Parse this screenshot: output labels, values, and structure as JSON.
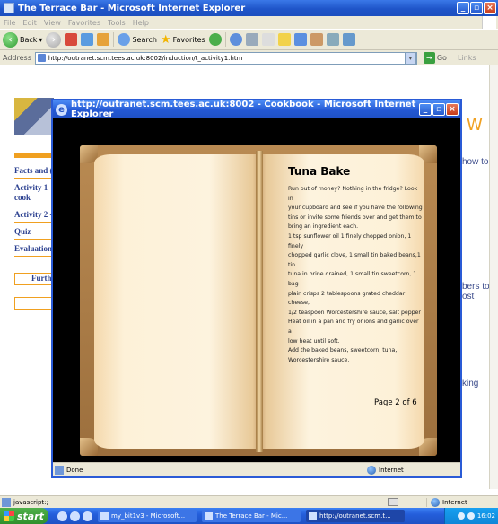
{
  "window": {
    "title": "The Terrace Bar - Microsoft Internet Explorer"
  },
  "menu": [
    "File",
    "Edit",
    "View",
    "Favorites",
    "Tools",
    "Help"
  ],
  "toolbar": {
    "back_label": "Back",
    "search_label": "Search",
    "favorites_label": "Favorites"
  },
  "address": {
    "label": "Address",
    "url": "http://outranet.scm.tees.ac.uk:8002/induction/t_activity1.htm",
    "go_label": "Go",
    "links_label": "Links"
  },
  "background_page": {
    "nav": [
      "Facts and (",
      "Activity 1 - cook",
      "Activity 2 -",
      "Quiz",
      "Evaluation"
    ],
    "further_label": "Furthe",
    "right_text_1": "how to",
    "right_text_2": "bers to\nost",
    "right_text_3": "king"
  },
  "popup": {
    "title": "http://outranet.scm.tees.ac.uk:8002 - Cookbook - Microsoft Internet Explorer",
    "recipe_title": "Tuna Bake",
    "recipe_lines": [
      "Run out of money? Nothing in the fridge? Look in",
      "your cupboard and see if you have the following",
      "tins or invite some friends over and get them to",
      "bring an ingredient each.",
      "1 tsp sunflower oil 1 finely chopped onion, 1 finely",
      "chopped garlic clove, 1 small tin baked beans,1 tin",
      "tuna in brine drained, 1 small tin sweetcorn, 1 bag",
      "plain crisps 2 tablespoons grated cheddar cheese,",
      "1/2 teaspoon Worcestershire sauce, salt pepper",
      "Heat oil in a pan and fry onions and garlic over a",
      "low heat until soft.",
      "Add the baked beans, sweetcorn, tuna,",
      "Worcestershire sauce."
    ],
    "page_number": "Page 2 of 6",
    "status": "Done",
    "zone": "Internet"
  },
  "status_bar": {
    "text": "javascript:;",
    "zone": "Internet"
  },
  "taskbar": {
    "start_label": "start",
    "tasks": [
      "my_bit1v3 - Microsoft...",
      "The Terrace Bar - Mic...",
      "http://outranet.scm.t..."
    ],
    "clock": "16:02"
  },
  "colors": {
    "titlebar": "#245edb",
    "book": "#9c6f3d",
    "page": "#fdf3de"
  }
}
